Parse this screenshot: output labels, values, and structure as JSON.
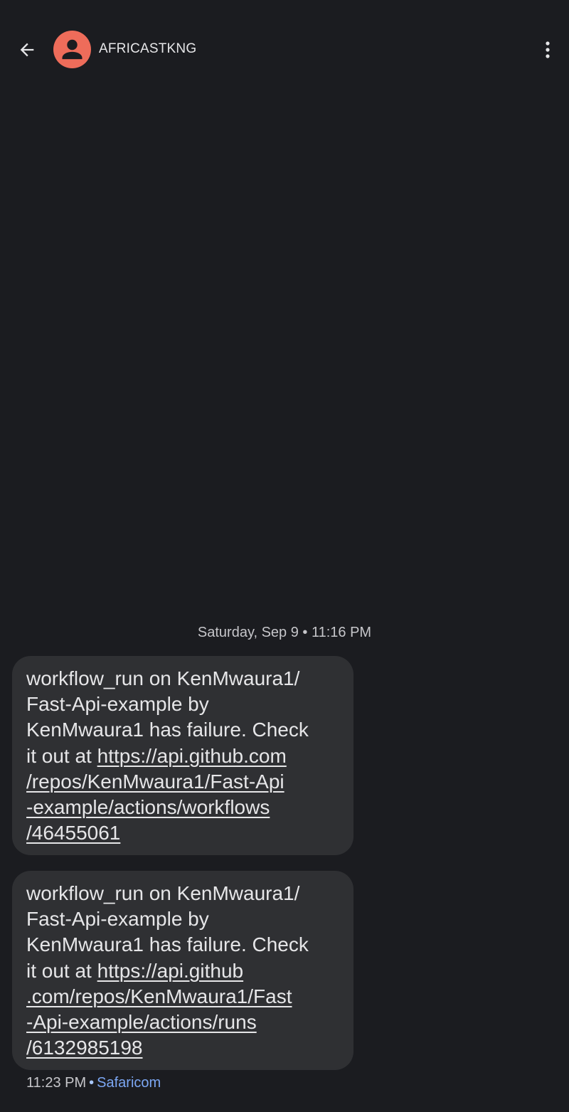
{
  "header": {
    "back_icon": "arrow-back-icon",
    "contact_name": "AFRICASTKNG",
    "avatar_icon": "person-icon",
    "avatar_color": "#ee6c5a",
    "menu_icon": "more-vert-icon"
  },
  "conversation": {
    "date_separator": "Saturday, Sep 9 • 11:16 PM",
    "messages": [
      {
        "lines": [
          "workflow_run on KenMwaura1/",
          "Fast-Api-example by",
          "KenMwaura1 has failure. Check",
          "it out at "
        ],
        "link_lines": [
          "https://api.github.com",
          "/repos/KenMwaura1/Fast-Api",
          "-example/actions/workflows",
          "/46455061"
        ]
      },
      {
        "lines": [
          "workflow_run on KenMwaura1/",
          "Fast-Api-example by",
          "KenMwaura1 has failure. Check",
          "it out at "
        ],
        "link_lines": [
          "https://api.github",
          ".com/repos/KenMwaura1/Fast",
          "-Api-example/actions/runs",
          "/6132985198"
        ]
      }
    ],
    "last_message_time": "11:23 PM",
    "separator_dot": "•",
    "carrier": "Safaricom"
  },
  "colors": {
    "background": "#1b1c20",
    "bubble": "#2f3033",
    "link_accent": "#7ca7f3"
  }
}
